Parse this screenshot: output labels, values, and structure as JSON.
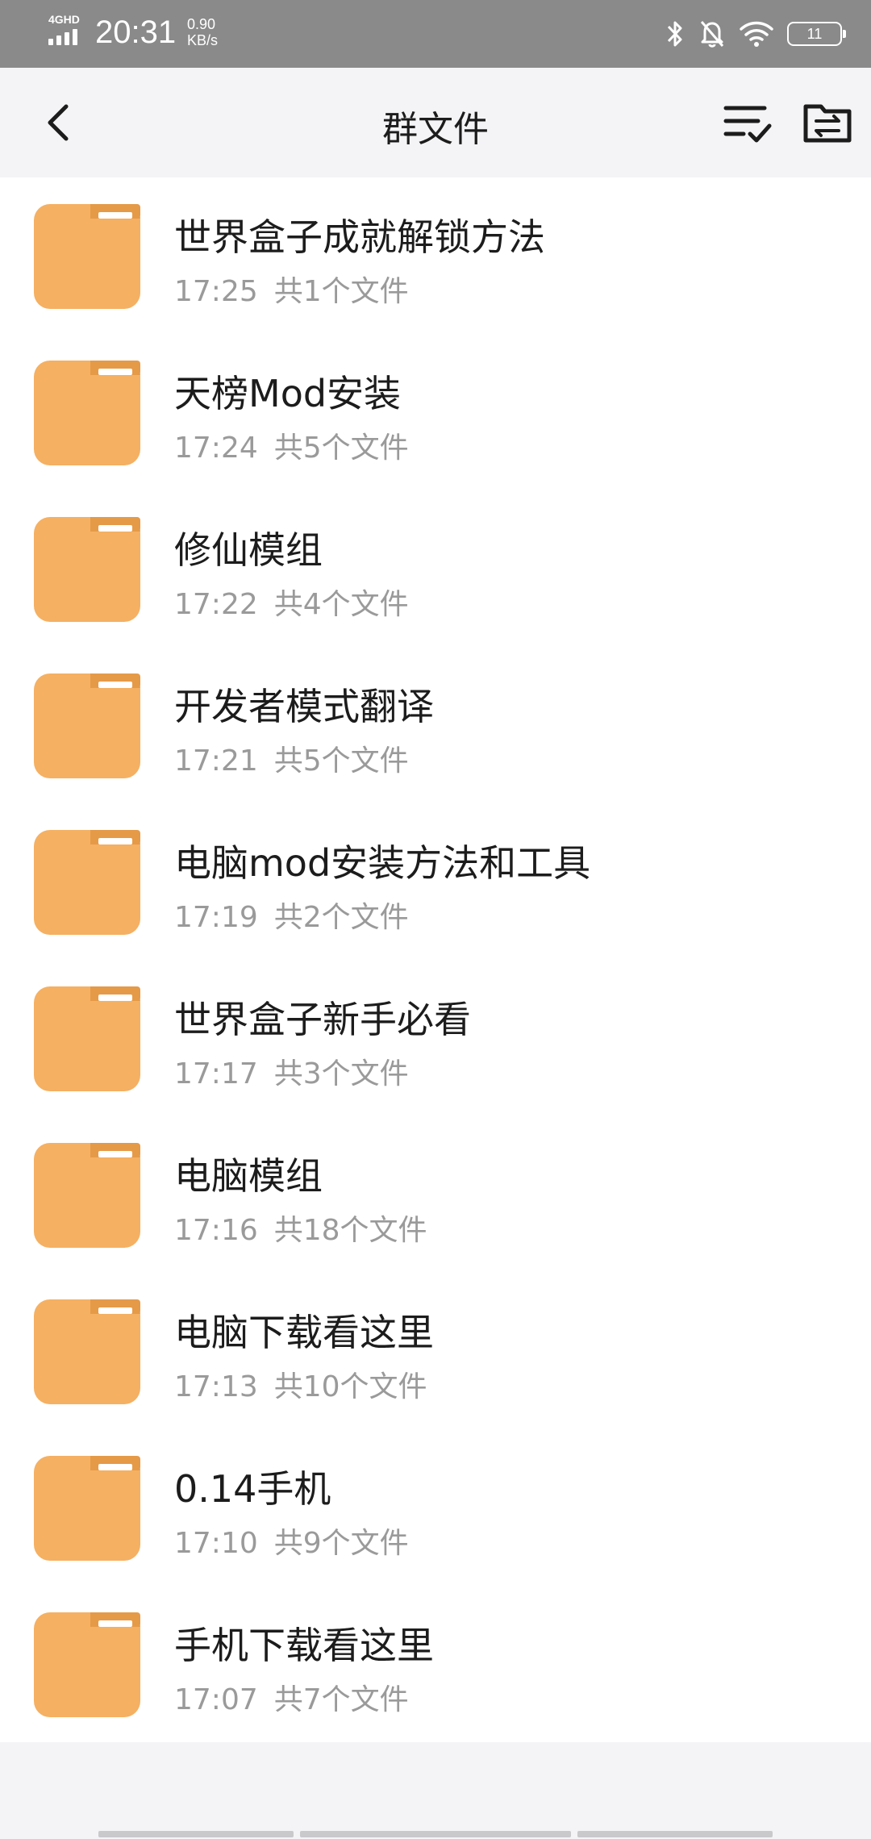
{
  "status_bar": {
    "network": "4GHD",
    "time": "20:31",
    "speed_value": "0.90",
    "speed_unit": "KB/s",
    "battery": "11",
    "icons": [
      "bluetooth-icon",
      "mute-icon",
      "wifi-icon",
      "battery-icon"
    ]
  },
  "header": {
    "title": "群文件",
    "back_icon": "chevron-left-icon",
    "right_icons": [
      "multi-select-icon",
      "folder-move-icon"
    ]
  },
  "colors": {
    "folder": "#F5B062",
    "folder_tab": "#E59A48",
    "text_primary": "#1C1C1C",
    "text_secondary": "#9A9A9A",
    "background": "#F4F4F6"
  },
  "items": [
    {
      "name": "世界盒子成就解锁方法",
      "time": "17:25",
      "count": "共1个文件"
    },
    {
      "name": "天榜Mod安装",
      "time": "17:24",
      "count": "共5个文件"
    },
    {
      "name": "修仙模组",
      "time": "17:22",
      "count": "共4个文件"
    },
    {
      "name": "开发者模式翻译",
      "time": "17:21",
      "count": "共5个文件"
    },
    {
      "name": "电脑mod安装方法和工具",
      "time": "17:19",
      "count": "共2个文件"
    },
    {
      "name": "世界盒子新手必看",
      "time": "17:17",
      "count": "共3个文件"
    },
    {
      "name": "电脑模组",
      "time": "17:16",
      "count": "共18个文件"
    },
    {
      "name": "电脑下载看这里",
      "time": "17:13",
      "count": "共10个文件"
    },
    {
      "name": "0.14手机",
      "time": "17:10",
      "count": "共9个文件"
    },
    {
      "name": "手机下载看这里",
      "time": "17:07",
      "count": "共7个文件"
    }
  ]
}
